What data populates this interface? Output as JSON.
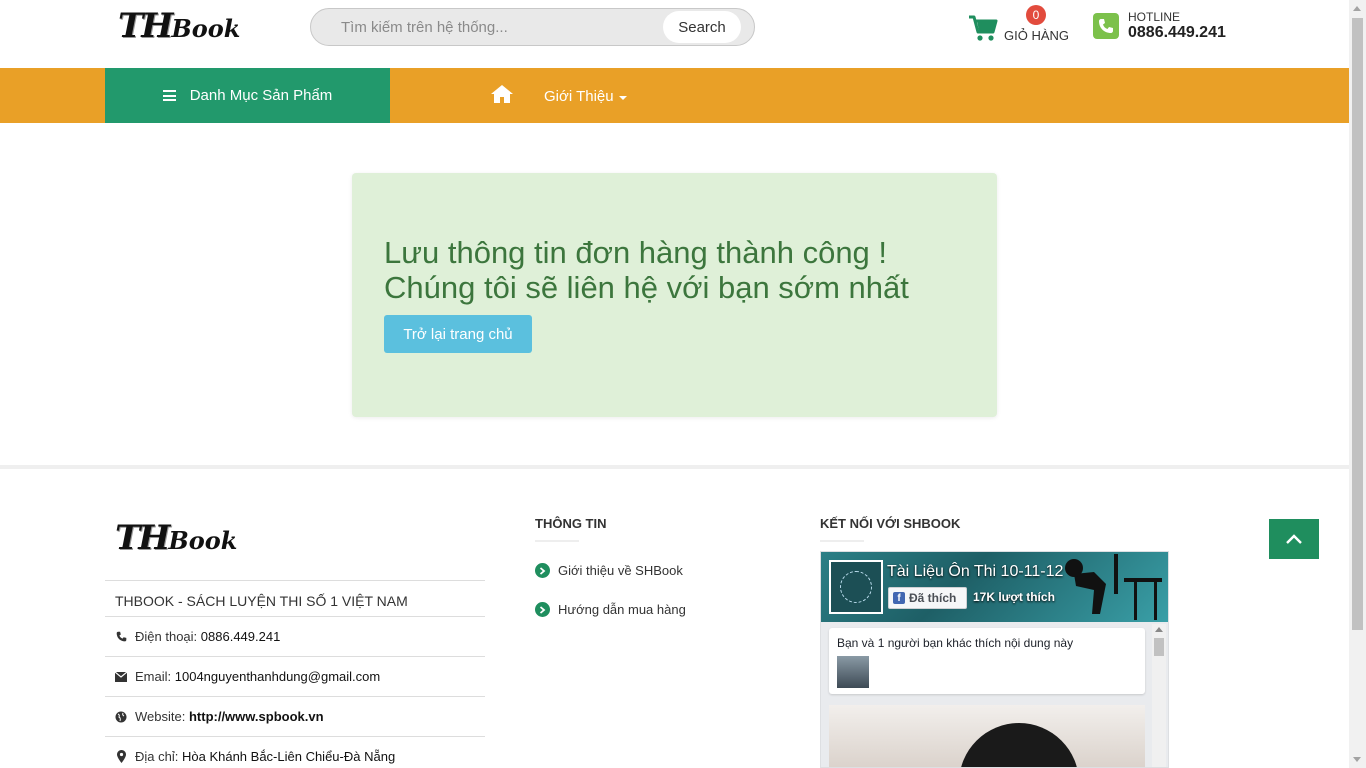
{
  "header": {
    "logo_th": "TH",
    "logo_book": "Book",
    "search_placeholder": "Tìm kiếm trên hệ thống...",
    "search_button": "Search",
    "cart_count": "0",
    "cart_label": "GIỎ HÀNG",
    "hotline_label": "HOTLINE",
    "hotline_number": "0886.449.241"
  },
  "nav": {
    "categories_label": "Danh Mục Sản Phẩm",
    "intro_label": "Giới Thiệu",
    "bg_color": "#e9a027",
    "category_color": "#22996c"
  },
  "success": {
    "line1": "Lưu thông tin đơn hàng thành công !",
    "line2": "Chúng tôi sẽ liên hệ với bạn sớm nhất",
    "button": "Trở lại trang chủ"
  },
  "footer": {
    "logo_th": "TH",
    "logo_book": "Book",
    "tagline": "THBOOK - SÁCH LUYỆN THI SỐ 1 VIỆT NAM",
    "phone_label": "Điện thoại:",
    "phone_value": "0886.449.241",
    "email_label": "Email:",
    "email_value": "1004nguyenthanhdung@gmail.com",
    "website_label": "Website:",
    "website_value": "http://www.spbook.vn",
    "address_label": "Địa chỉ:",
    "address_value": "Hòa Khánh Bắc-Liên Chiểu-Đà Nẵng",
    "info_heading": "THÔNG TIN",
    "info_links": [
      "Giới thiệu về SHBook",
      "Hướng dẫn mua hàng"
    ],
    "connect_heading": "KẾT NỐI VỚI SHBOOK"
  },
  "facebook": {
    "page_title": "Tài Liệu Ôn Thi 10-11-12",
    "liked_label": "Đã thích",
    "likes_count": "17K lượt thích",
    "friends_text": "Bạn và 1 người bạn khác thích nội dung này"
  }
}
